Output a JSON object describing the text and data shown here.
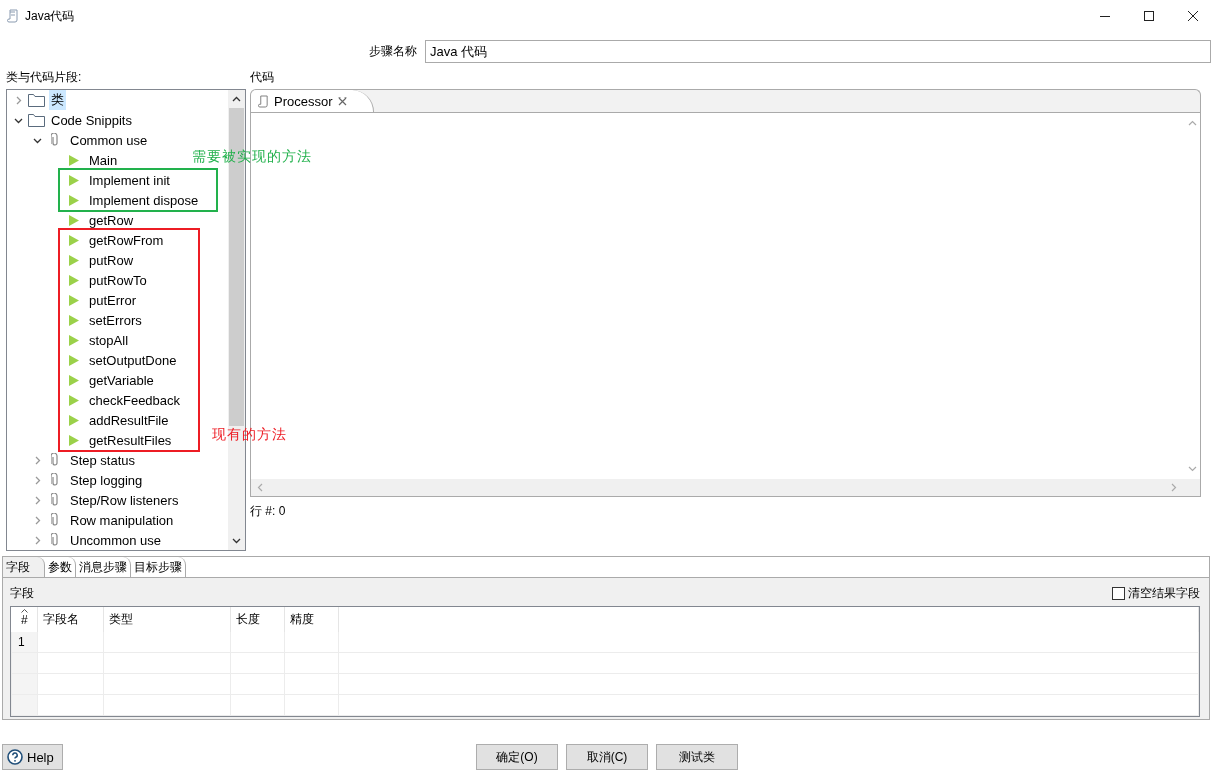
{
  "window": {
    "title": "Java代码"
  },
  "step_name": {
    "label": "步骤名称",
    "value": "Java 代码"
  },
  "snippets": {
    "label": "类与代码片段:",
    "tree": [
      {
        "kind": "folder",
        "label": "类",
        "expanded": false,
        "selected": true
      },
      {
        "kind": "folder",
        "label": "Code Snippits",
        "expanded": true,
        "selected": false,
        "children": [
          {
            "kind": "category",
            "label": "Common use",
            "expanded": true,
            "selected": false,
            "children": [
              {
                "kind": "method",
                "label": "Main",
                "selected": false
              },
              {
                "kind": "callout",
                "color": "#22b14c",
                "note": "需要被实现的方法",
                "items": [
                  {
                    "kind": "method",
                    "label": "Implement init",
                    "selected": false
                  },
                  {
                    "kind": "method",
                    "label": "Implement dispose",
                    "selected": false
                  }
                ]
              },
              {
                "kind": "method",
                "label": "getRow",
                "selected": false
              },
              {
                "kind": "callout",
                "color": "#ed1c24",
                "note": "现有的方法",
                "items": [
                  {
                    "kind": "method",
                    "label": "getRowFrom",
                    "selected": false
                  },
                  {
                    "kind": "method",
                    "label": "putRow",
                    "selected": false
                  },
                  {
                    "kind": "method",
                    "label": "putRowTo",
                    "selected": false
                  },
                  {
                    "kind": "method",
                    "label": "putError",
                    "selected": false
                  },
                  {
                    "kind": "method",
                    "label": "setErrors",
                    "selected": false
                  },
                  {
                    "kind": "method",
                    "label": "stopAll",
                    "selected": false
                  },
                  {
                    "kind": "method",
                    "label": "setOutputDone",
                    "selected": false
                  },
                  {
                    "kind": "method",
                    "label": "getVariable",
                    "selected": false
                  },
                  {
                    "kind": "method",
                    "label": "checkFeedback",
                    "selected": false
                  },
                  {
                    "kind": "method",
                    "label": "addResultFile",
                    "selected": false
                  },
                  {
                    "kind": "method",
                    "label": "getResultFiles",
                    "selected": false
                  }
                ]
              }
            ]
          },
          {
            "kind": "category",
            "label": "Step status",
            "expanded": false,
            "selected": false
          },
          {
            "kind": "category",
            "label": "Step logging",
            "expanded": false,
            "selected": false
          },
          {
            "kind": "category",
            "label": "Step/Row listeners",
            "expanded": false,
            "selected": false
          },
          {
            "kind": "category",
            "label": "Row manipulation",
            "expanded": false,
            "selected": false
          },
          {
            "kind": "category",
            "label": "Uncommon use",
            "expanded": false,
            "selected": false
          }
        ]
      }
    ]
  },
  "code": {
    "label": "代码",
    "tabs": [
      {
        "label": "Processor",
        "selected": true
      }
    ],
    "position": "行 #: 0"
  },
  "bottom_tabs": [
    {
      "label": "字段",
      "selected": true
    },
    {
      "label": "参数",
      "selected": false
    },
    {
      "label": "消息步骤",
      "selected": false
    },
    {
      "label": "目标步骤",
      "selected": false
    }
  ],
  "fields": {
    "label": "字段",
    "clear_option": {
      "label": "清空结果字段",
      "checked": false
    },
    "columns": [
      "#",
      "字段名",
      "类型",
      "长度",
      "精度"
    ],
    "rows": [
      {
        "number": "1"
      }
    ]
  },
  "help_button": {
    "label": "Help"
  },
  "buttons": [
    "确定(O)",
    "取消(C)",
    "测试类"
  ]
}
